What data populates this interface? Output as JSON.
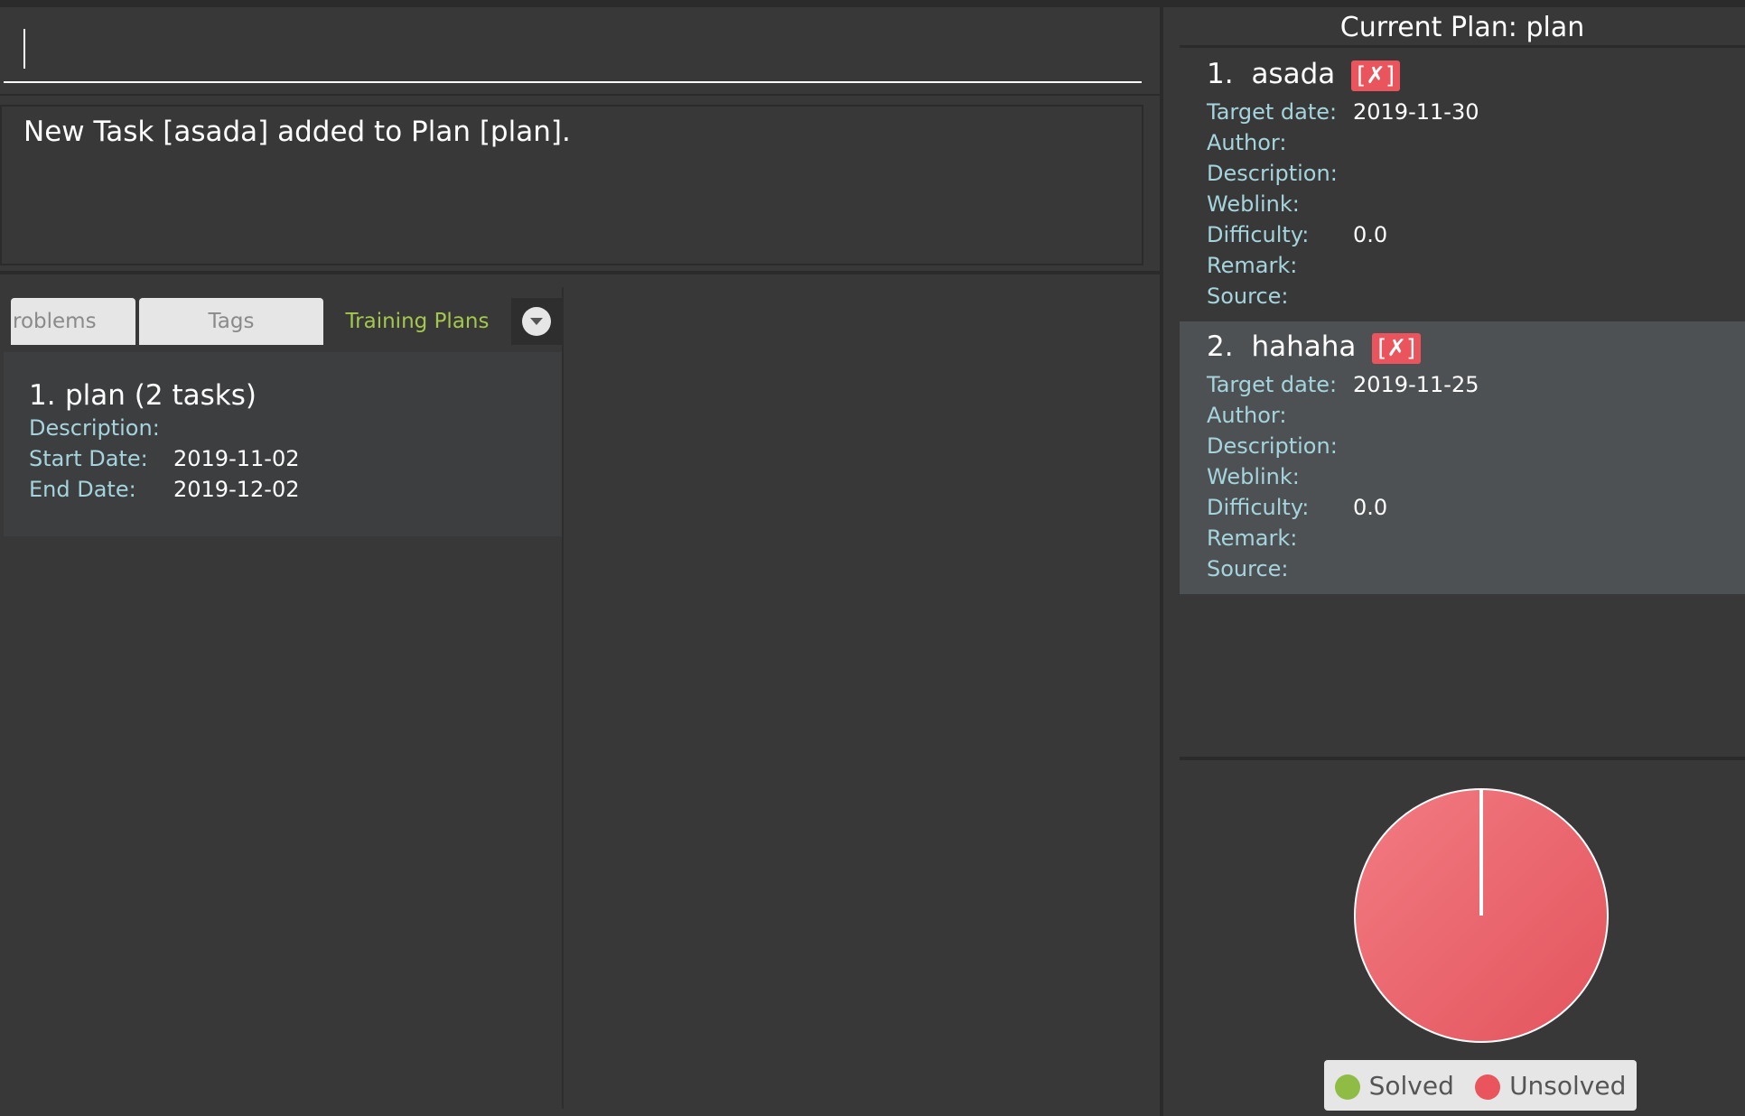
{
  "command_box": {
    "value": ""
  },
  "result": {
    "text": "New Task [asada] added to Plan [plan]."
  },
  "tabs": [
    {
      "label": "roblems"
    },
    {
      "label": "Tags"
    },
    {
      "label": "Training Plans"
    }
  ],
  "plans": [
    {
      "index": "1.",
      "title": "plan (2 tasks)",
      "description_label": "Description:",
      "description": "",
      "start_label": "Start Date:",
      "start": "2019-11-02",
      "end_label": "End Date:",
      "end": "2019-12-02"
    }
  ],
  "current_plan": {
    "header": "Current Plan: plan",
    "tasks": [
      {
        "index": "1.",
        "name": "asada",
        "badge": "[✗]",
        "target_label": "Target date:",
        "target": "2019-11-30",
        "author_label": "Author:",
        "description_label": "Description:",
        "weblink_label": "Weblink:",
        "difficulty_label": "Difficulty:",
        "difficulty": "0.0",
        "remark_label": "Remark:",
        "source_label": "Source:"
      },
      {
        "index": "2.",
        "name": "hahaha",
        "badge": "[✗]",
        "target_label": "Target date:",
        "target": "2019-11-25",
        "author_label": "Author:",
        "description_label": "Description:",
        "weblink_label": "Weblink:",
        "difficulty_label": "Difficulty:",
        "difficulty": "0.0",
        "remark_label": "Remark:",
        "source_label": "Source:"
      }
    ]
  },
  "chart_data": {
    "type": "pie",
    "slices": [
      {
        "label": "Solved",
        "value": 0,
        "color": "#8fbc45"
      },
      {
        "label": "Unsolved",
        "value": 2,
        "color": "#e9545d"
      }
    ]
  },
  "legend": {
    "solved": "Solved",
    "unsolved": "Unsolved"
  },
  "colors": {
    "accent_green": "#a3c84b",
    "label_blue": "#a6d4dc",
    "badge_red": "#e9545d"
  }
}
